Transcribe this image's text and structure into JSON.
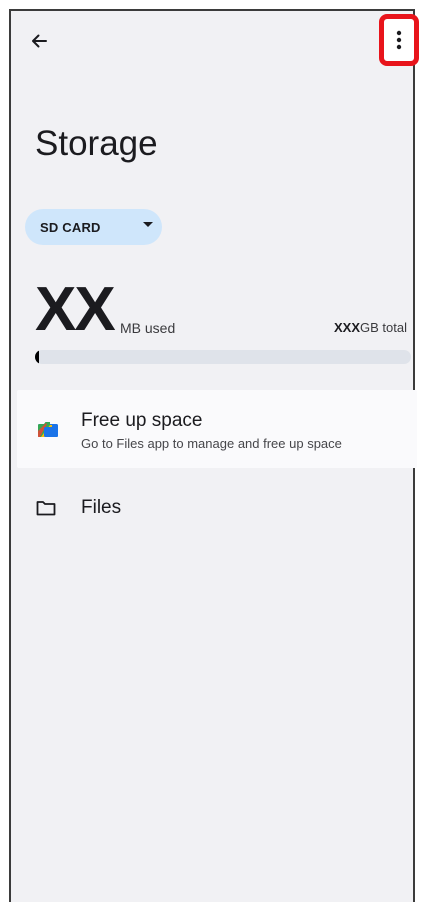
{
  "toolbar": {
    "back_icon": "arrow-back-icon",
    "more_icon": "more-vert-icon",
    "highlight_color": "#e8141b"
  },
  "page": {
    "title": "Storage"
  },
  "volume_selector": {
    "selected": "SD CARD",
    "chip_color": "#cfe6fb"
  },
  "usage": {
    "used_value": "XX",
    "used_unit": "MB used",
    "total_value": "XXX",
    "total_unit": "GB total",
    "fill_fraction": 0.01
  },
  "list": {
    "free_up": {
      "icon": "files-app-icon",
      "title": "Free up space",
      "subtitle": "Go to Files app to manage and free up space"
    },
    "files": {
      "icon": "folder-icon",
      "label": "Files"
    }
  }
}
